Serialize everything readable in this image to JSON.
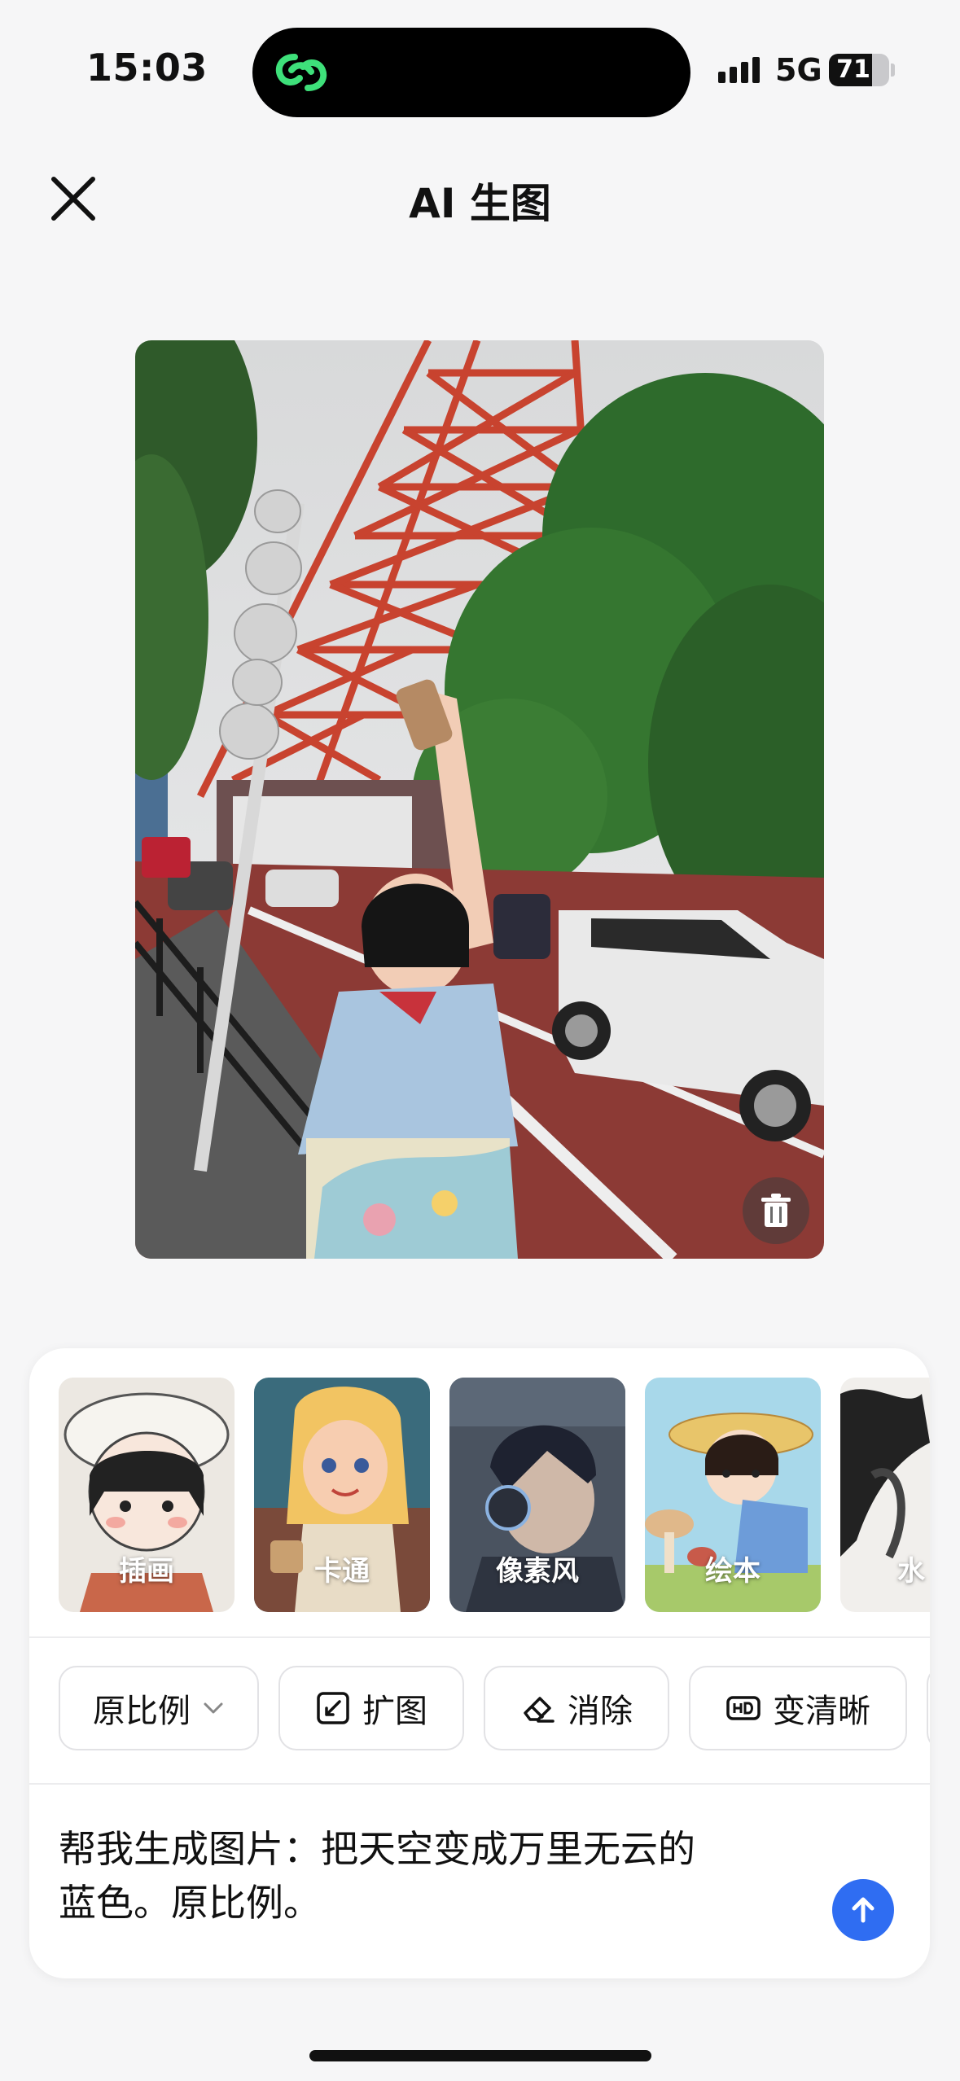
{
  "status_bar": {
    "time": "15:03",
    "network": "5G",
    "battery": "71",
    "battery_level": 0.71
  },
  "header": {
    "title": "AI 生图",
    "close_icon": "close-icon"
  },
  "photo": {
    "delete_icon": "trash-icon",
    "tower_color": "#c8432f",
    "road_color": "#8c3a35"
  },
  "styles": [
    {
      "label": "插画"
    },
    {
      "label": "卡通"
    },
    {
      "label": "像素风"
    },
    {
      "label": "绘本"
    },
    {
      "label": "水"
    }
  ],
  "tools": {
    "ratio": {
      "label": "原比例",
      "icon": "chevron-down-icon"
    },
    "expand": {
      "label": "扩图",
      "icon": "expand-icon"
    },
    "erase": {
      "label": "消除",
      "icon": "eraser-icon"
    },
    "enhance": {
      "label": "变清晰",
      "icon": "hd-icon"
    }
  },
  "prompt": {
    "line1": "帮我生成图片：把天空变成万里无云的",
    "line2": "蓝色。原比例。"
  },
  "colors": {
    "accent": "#2f6df2",
    "island_icon": "#3ee07a"
  }
}
